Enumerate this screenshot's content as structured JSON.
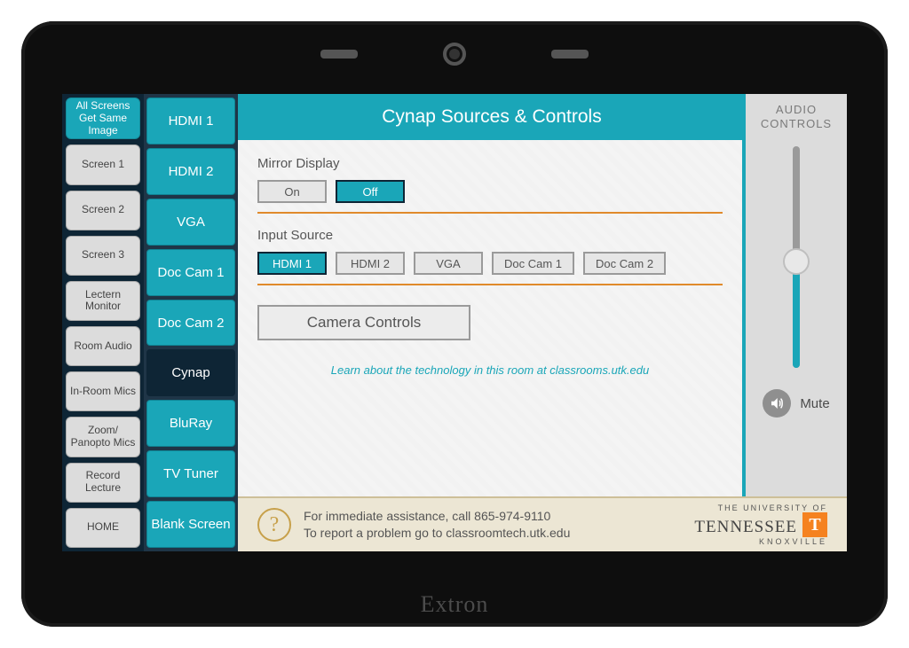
{
  "device": {
    "brand": "Extron"
  },
  "leftNav": {
    "items": [
      {
        "label": "All Screens Get Same Image",
        "active": true
      },
      {
        "label": "Screen 1"
      },
      {
        "label": "Screen 2"
      },
      {
        "label": "Screen 3"
      },
      {
        "label": "Lectern Monitor"
      },
      {
        "label": "Room Audio"
      },
      {
        "label": "In-Room Mics"
      },
      {
        "label": "Zoom/ Panopto Mics"
      },
      {
        "label": "Record Lecture"
      },
      {
        "label": "HOME"
      }
    ]
  },
  "sources": {
    "items": [
      {
        "label": "HDMI 1"
      },
      {
        "label": "HDMI 2"
      },
      {
        "label": "VGA"
      },
      {
        "label": "Doc Cam 1"
      },
      {
        "label": "Doc Cam 2"
      },
      {
        "label": "Cynap",
        "active": true
      },
      {
        "label": "BluRay"
      },
      {
        "label": "TV Tuner"
      },
      {
        "label": "Blank Screen"
      }
    ]
  },
  "main": {
    "title": "Cynap Sources & Controls",
    "mirror": {
      "label": "Mirror Display",
      "on": "On",
      "off": "Off",
      "selected": "Off"
    },
    "input": {
      "label": "Input Source",
      "options": [
        "HDMI 1",
        "HDMI 2",
        "VGA",
        "Doc Cam 1",
        "Doc Cam 2"
      ],
      "selected": "HDMI 1"
    },
    "camera_controls": "Camera Controls",
    "learn": "Learn about the technology in this room at classrooms.utk.edu"
  },
  "audio": {
    "title_line1": "AUDIO",
    "title_line2": "CONTROLS",
    "mute": "Mute",
    "level_percent": 48
  },
  "footer": {
    "help_icon": "?",
    "line1": "For immediate assistance, call 865-974-9110",
    "line2": "To report a problem go to classroomtech.utk.edu",
    "logo": {
      "line1": "THE UNIVERSITY OF",
      "wordmark": "TENNESSEE",
      "mark": "T",
      "line3": "KNOXVILLE"
    }
  }
}
